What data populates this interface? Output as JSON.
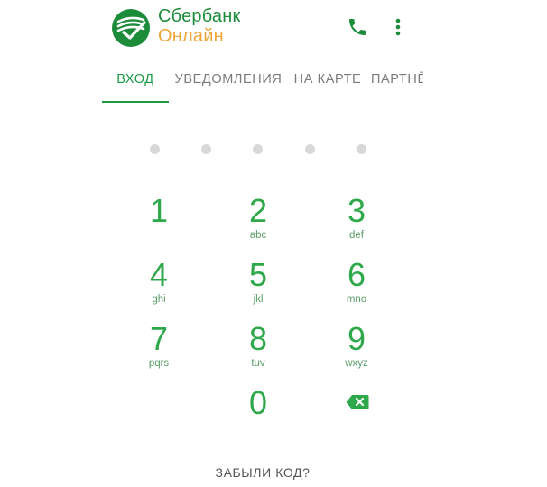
{
  "app": {
    "brand_line1": "Сбербанк",
    "brand_line2": "Онлайн",
    "colors": {
      "brand_green": "#1c8c3a",
      "brand_orange": "#f0a53a",
      "accent_green": "#1a9a45",
      "keypad_green": "#2ea84a",
      "dot_gray": "#d8d8d8"
    }
  },
  "toolbar": {
    "phone_icon": "phone-icon",
    "more_icon": "more-vertical-icon"
  },
  "tabs": [
    {
      "label": "ВХОД",
      "active": true
    },
    {
      "label": "УВЕДОМЛЕНИЯ",
      "active": false
    },
    {
      "label": "НА КАРТЕ",
      "active": false
    },
    {
      "label": "ПАРТНЁ",
      "active": false
    }
  ],
  "pin": {
    "length": 5,
    "entered": 0
  },
  "keypad": [
    {
      "digit": "1",
      "letters": ""
    },
    {
      "digit": "2",
      "letters": "abc"
    },
    {
      "digit": "3",
      "letters": "def"
    },
    {
      "digit": "4",
      "letters": "ghi"
    },
    {
      "digit": "5",
      "letters": "jkl"
    },
    {
      "digit": "6",
      "letters": "mno"
    },
    {
      "digit": "7",
      "letters": "pqrs"
    },
    {
      "digit": "8",
      "letters": "tuv"
    },
    {
      "digit": "9",
      "letters": "wxyz"
    },
    {
      "digit": "0",
      "letters": ""
    }
  ],
  "backspace_icon": "backspace-icon",
  "forgot_label": "ЗАБЫЛИ КОД?"
}
